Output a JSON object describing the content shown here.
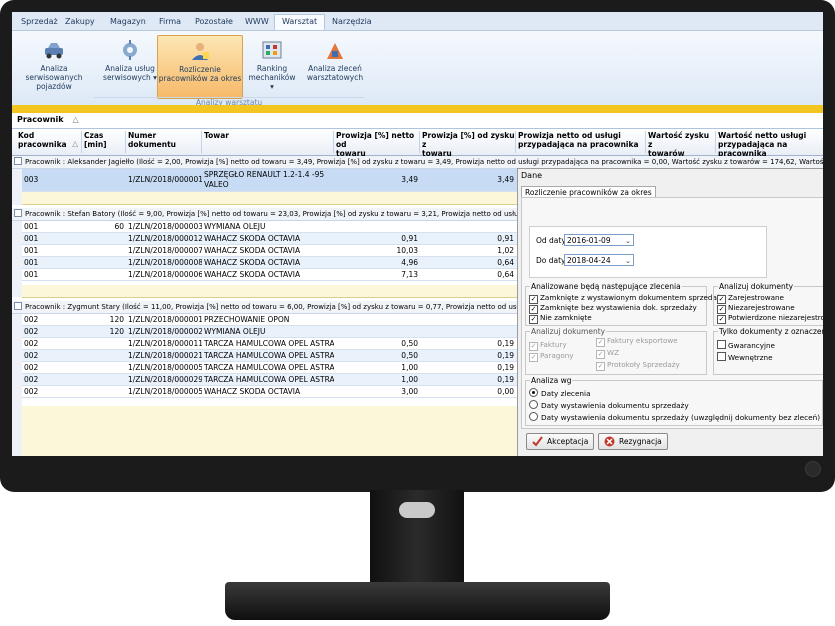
{
  "ribbon": {
    "tabs": [
      "Sprzedaż",
      "Zakupy",
      "Magazyn",
      "Firma",
      "Pozostałe",
      "WWW",
      "Warsztat",
      "Narzędzia"
    ],
    "active_tab": "Warsztat",
    "buttons": [
      {
        "label1": "Analiza serwisowanych",
        "label2": "pojazdów"
      },
      {
        "label1": "Analiza usług",
        "label2": "serwisowych ▾"
      },
      {
        "label1": "Rozliczenie",
        "label2": "pracowników za okres"
      },
      {
        "label1": "Ranking",
        "label2": "mechaników ▾"
      },
      {
        "label1": "Analiza zleceń",
        "label2": "warsztatowych"
      }
    ],
    "group_label": "Analizy warsztatu"
  },
  "grid": {
    "group_by_chip": "Pracownik",
    "columns": [
      {
        "l1": "Kod",
        "l2": "pracownika"
      },
      {
        "l1": "Czas [min]",
        "l2": ""
      },
      {
        "l1": "Numer dokumentu",
        "l2": ""
      },
      {
        "l1": "Towar",
        "l2": ""
      },
      {
        "l1": "Prowizja [%] netto od",
        "l2": "towaru"
      },
      {
        "l1": "Prowizja [%] od zysku z",
        "l2": "towaru"
      },
      {
        "l1": "Prowizja netto od usługi",
        "l2": "przypadająca na pracownika"
      },
      {
        "l1": "Wartość zysku z",
        "l2": "towarów"
      },
      {
        "l1": "Wartość netto usługi",
        "l2": "przypadająca na pracownika"
      }
    ],
    "groups": [
      {
        "header": "Pracownik : Aleksander Jagiełło (Ilość = 2,00, Prowizja [%] netto od towaru = 3,49, Prowizja [%] od zysku z towaru = 3,49, Prowizja netto od usługi przypadająca na pracownika = 0,00, Wartość zysku z towarów = 174,62, Wartość netto usługi przypadająca na p",
        "rows": [
          {
            "kod": "003",
            "czas": "",
            "nr": "1/ZLN/2018/000001",
            "towar": "SPRZĘGŁO RENAULT 1.2-1.4 -95",
            "towar2": "VALEO",
            "p1": "3,49",
            "p2": "3,49"
          }
        ]
      },
      {
        "header": "Pracownik : Stefan Batory (Ilość = 9,00, Prowizja [%] netto od towaru = 23,03, Prowizja [%] od zysku z towaru = 3,21, Prowizja netto od usługi przypadająca na p",
        "rows": [
          {
            "kod": "001",
            "czas": "60",
            "nr": "1/ZLN/2018/000003",
            "towar": "WYMIANA OLEJU",
            "p1": "",
            "p2": ""
          },
          {
            "kod": "001",
            "czas": "",
            "nr": "1/ZLN/2018/000012",
            "towar": "WAHACZ SKODA OCTAVIA",
            "p1": "0,91",
            "p2": "0,91"
          },
          {
            "kod": "001",
            "czas": "",
            "nr": "1/ZLN/2018/000007",
            "towar": "WAHACZ SKODA OCTAVIA",
            "p1": "10,03",
            "p2": "1,02"
          },
          {
            "kod": "001",
            "czas": "",
            "nr": "1/ZLN/2018/000008",
            "towar": "WAHACZ SKODA OCTAVIA",
            "p1": "4,96",
            "p2": "0,64"
          },
          {
            "kod": "001",
            "czas": "",
            "nr": "1/ZLN/2018/000006",
            "towar": "WAHACZ SKODA OCTAVIA",
            "p1": "7,13",
            "p2": "0,64"
          }
        ]
      },
      {
        "header": "Pracownik : Zygmunt Stary (Ilość = 11,00, Prowizja [%] netto od towaru = 6,00, Prowizja [%] od zysku z towaru = 0,77, Prowizja netto od usługi przypadająca na p",
        "rows": [
          {
            "kod": "002",
            "czas": "120",
            "nr": "1/ZLN/2018/000001",
            "towar": "PRZECHOWANIE OPON",
            "p1": "",
            "p2": ""
          },
          {
            "kod": "002",
            "czas": "120",
            "nr": "1/ZLN/2018/000002",
            "towar": "WYMIANA OLEJU",
            "p1": "",
            "p2": ""
          },
          {
            "kod": "002",
            "czas": "",
            "nr": "1/ZLN/2018/000011",
            "towar": "TARCZA HAMULCOWA OPEL ASTRA",
            "p1": "0,50",
            "p2": "0,19"
          },
          {
            "kod": "002",
            "czas": "",
            "nr": "1/ZLN/2018/000021",
            "towar": "TARCZA HAMULCOWA OPEL ASTRA",
            "p1": "0,50",
            "p2": "0,19"
          },
          {
            "kod": "002",
            "czas": "",
            "nr": "1/ZLN/2018/000005",
            "towar": "TARCZA HAMULCOWA OPEL ASTRA",
            "p1": "1,00",
            "p2": "0,19"
          },
          {
            "kod": "002",
            "czas": "",
            "nr": "1/ZLN/2018/000029",
            "towar": "TARCZA HAMULCOWA OPEL ASTRA",
            "p1": "1,00",
            "p2": "0,19"
          },
          {
            "kod": "002",
            "czas": "",
            "nr": "1/ZLN/2018/000005",
            "towar": "WAHACZ SKODA OCTAVIA",
            "p1": "3,00",
            "p2": "0,00"
          }
        ]
      }
    ]
  },
  "dialog": {
    "title": "Dane",
    "tab": "Rozliczenie pracowników za okres",
    "od_label": "Od daty",
    "od_value": "2016-01-09",
    "do_label": "Do daty",
    "do_value": "2018-04-24",
    "zlecenia": {
      "legend": "Analizowane będą następujące zlecenia",
      "items": [
        {
          "label": "Zamknięte z wystawionym dokumentem sprzedaży",
          "checked": "✓"
        },
        {
          "label": "Zamknięte bez wystawienia dok. sprzedaży",
          "checked": "✓"
        },
        {
          "label": "Nie zamknięte",
          "checked": "✓"
        }
      ]
    },
    "analizuj": {
      "legend": "Analizuj dokumenty",
      "items": [
        {
          "label": "Zarejestrowane",
          "checked": "✓"
        },
        {
          "label": "Niezarejestrowane",
          "checked": "✓"
        },
        {
          "label": "Potwierdzone niezarejestrowane",
          "checked": "✓"
        }
      ]
    },
    "dokumenty": {
      "legend": "Analizuj dokumenty",
      "items": [
        {
          "label": "Faktury",
          "checked": "✓"
        },
        {
          "label": "Paragony",
          "checked": "✓"
        },
        {
          "label": "Faktury eksportowe",
          "checked": "✓"
        },
        {
          "label": "WZ",
          "checked": "✓"
        },
        {
          "label": "Protokoły Sprzedaży",
          "checked": "✓"
        }
      ]
    },
    "oznaczenie": {
      "legend": "Tylko dokumenty z oznaczeniem",
      "items": [
        {
          "label": "Gwarancyjne",
          "checked": ""
        },
        {
          "label": "Wewnętrzne",
          "checked": ""
        }
      ]
    },
    "analiza_wg": {
      "legend": "Analiza wg",
      "options": [
        "Daty zlecenia",
        "Daty wystawienia dokumentu sprzedaży",
        "Daty wystawienia dokumentu sprzedaży (uwzględnij dokumenty bez zleceń)"
      ]
    },
    "accept": "Akceptacja",
    "reject": "Rezygnacja"
  },
  "colors": {
    "accent": "#f2c61f",
    "ribbon_selected": "#f6b969",
    "row_selected": "#c7dcf4"
  }
}
